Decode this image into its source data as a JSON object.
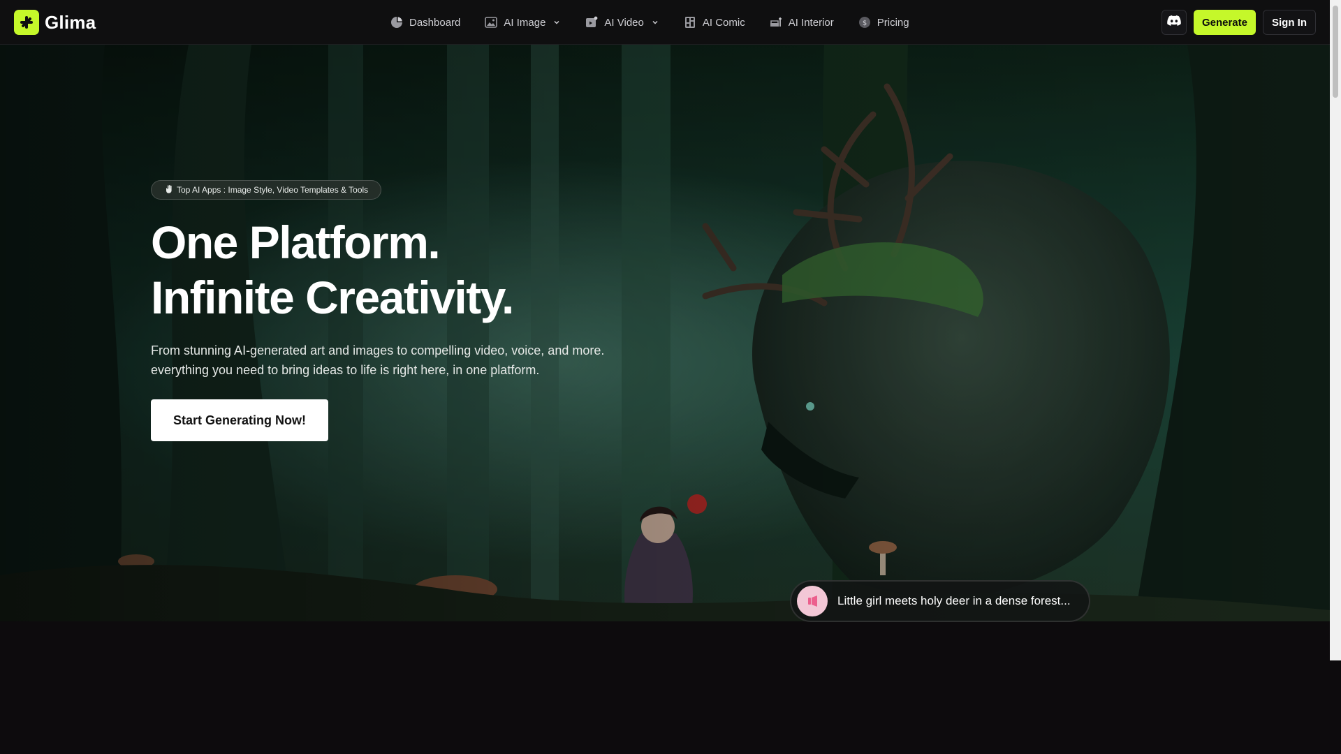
{
  "brand": {
    "name": "Glima",
    "accent": "#c5f82a"
  },
  "nav": {
    "items": [
      {
        "label": "Dashboard",
        "icon": "dashboard-icon"
      },
      {
        "label": "AI Image",
        "icon": "image-icon",
        "has_dropdown": true
      },
      {
        "label": "AI Video",
        "icon": "video-icon",
        "has_dropdown": true
      },
      {
        "label": "AI Comic",
        "icon": "comic-icon"
      },
      {
        "label": "AI Interior",
        "icon": "interior-icon"
      },
      {
        "label": "Pricing",
        "icon": "pricing-icon"
      }
    ]
  },
  "actions": {
    "generate": "Generate",
    "signin": "Sign In",
    "discord_icon": "discord-icon"
  },
  "hero": {
    "pill": "Top AI Apps : Image Style, Video Templates & Tools",
    "title_line1": "One Platform.",
    "title_line2": "Infinite Creativity.",
    "subtitle": "From stunning AI-generated art and images to compelling video, voice, and more. everything you need to bring ideas to life is right here, in one platform.",
    "cta": "Start Generating Now!",
    "caption": "Little girl meets holy deer in a dense forest..."
  }
}
